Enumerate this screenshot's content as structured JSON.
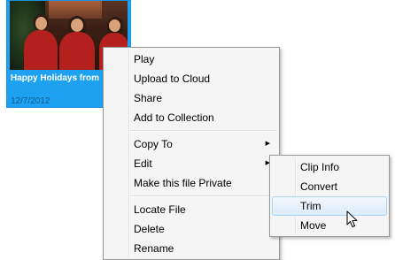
{
  "video_tile": {
    "title": "Happy Holidays from",
    "date": "12/7/2012"
  },
  "context_menu": {
    "items": [
      {
        "label": "Play"
      },
      {
        "label": "Upload to Cloud"
      },
      {
        "label": "Share"
      },
      {
        "label": "Add to Collection"
      },
      {
        "label": "Copy To",
        "has_submenu": true
      },
      {
        "label": "Edit",
        "has_submenu": true
      },
      {
        "label": "Make this file Private"
      },
      {
        "label": "Locate File"
      },
      {
        "label": "Delete"
      },
      {
        "label": "Rename"
      }
    ]
  },
  "edit_submenu": {
    "items": [
      {
        "label": "Clip Info"
      },
      {
        "label": "Convert"
      },
      {
        "label": "Trim",
        "highlighted": true
      },
      {
        "label": "Move"
      }
    ]
  },
  "icons": {
    "submenu_arrow": "triangle-right-icon",
    "cursor": "mouse-pointer-icon"
  },
  "colors": {
    "selection_tile": "#1ea1f0",
    "menu_background": "#f5f5f5",
    "menu_hover": "#dcecfc",
    "menu_hover_border": "#a8d8f7"
  }
}
